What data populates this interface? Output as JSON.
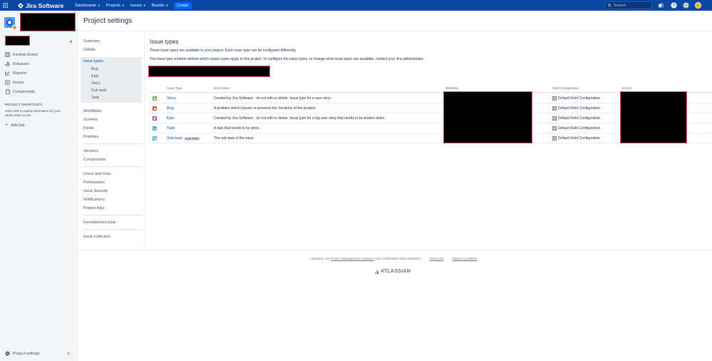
{
  "topbar": {
    "product_name": "Jira Software",
    "nav": [
      {
        "label": "Dashboards"
      },
      {
        "label": "Projects"
      },
      {
        "label": "Issues"
      },
      {
        "label": "Boards"
      }
    ],
    "create_label": "Create",
    "search_placeholder": "Search"
  },
  "sidebar": {
    "items": [
      {
        "label": "Kanban board",
        "icon": "board-icon"
      },
      {
        "label": "Releases",
        "icon": "ship-icon"
      },
      {
        "label": "Reports",
        "icon": "chart-icon"
      },
      {
        "label": "Issues",
        "icon": "issues-icon"
      },
      {
        "label": "Components",
        "icon": "puzzle-icon"
      }
    ],
    "shortcuts_title": "PROJECT SHORTCUTS",
    "shortcuts_desc": "Add a link to useful information for your whole team to see.",
    "add_link_label": "Add link",
    "footer_label": "Project settings"
  },
  "page_title": "Project settings",
  "settings_nav": {
    "group1": [
      "Summary",
      "Details"
    ],
    "issue_types_label": "Issue types",
    "issue_types_children": [
      "Bug",
      "Epic",
      "Story",
      "Sub-task",
      "Task"
    ],
    "group2": [
      "Workflows",
      "Screens",
      "Fields",
      "Priorities"
    ],
    "group3": [
      "Versions",
      "Components"
    ],
    "group4": [
      "Users and roles",
      "Permissions",
      "Issue Security",
      "Notifications",
      "Project links"
    ],
    "group5": [
      "Development tools"
    ],
    "group6": [
      "Issue collectors"
    ]
  },
  "main": {
    "title": "Issue types",
    "desc1": "These issue types are available in your project. Each issue type can be configured differently.",
    "desc2": "The issue type scheme defines which issues types apply to this project. To configure the issue types, or change what issue types are available, contact your Jira administrator.",
    "columns": {
      "issue_type": "Issue Type",
      "description": "Description",
      "workflow": "Workflow",
      "field_configuration": "Field configuration",
      "screen": "Screen"
    },
    "rows": [
      {
        "name": "Story",
        "badge": "",
        "description": "Created by Jira Software - do not edit or delete. Issue type for a user story.",
        "field_config": "Default Field Configuration",
        "color": "#63ba3c"
      },
      {
        "name": "Bug",
        "badge": "",
        "description": "A problem which impairs or prevents the functions of the product.",
        "field_config": "Default Field Configuration",
        "color": "#e5493a"
      },
      {
        "name": "Epic",
        "badge": "",
        "description": "Created by Jira Software - do not edit or delete. Issue type for a big user story that needs to be broken down.",
        "field_config": "Default Field Configuration",
        "color": "#904ee2"
      },
      {
        "name": "Task",
        "badge": "",
        "description": "A task that needs to be done.",
        "field_config": "Default Field Configuration",
        "color": "#4bade8"
      },
      {
        "name": "Sub-task",
        "badge": "SUB-TASK",
        "description": "The sub-task of the issue",
        "field_config": "Default Field Configuration",
        "color": "#4bade8"
      }
    ]
  },
  "footer": {
    "prefix": "Atlassian Jira",
    "link1": "Project Management Software",
    "version": "(v9.4.14#940001-sha1:829e8cc)",
    "link2": "About Jira",
    "link3": "Report a problem",
    "brand": "ATLASSIAN"
  }
}
